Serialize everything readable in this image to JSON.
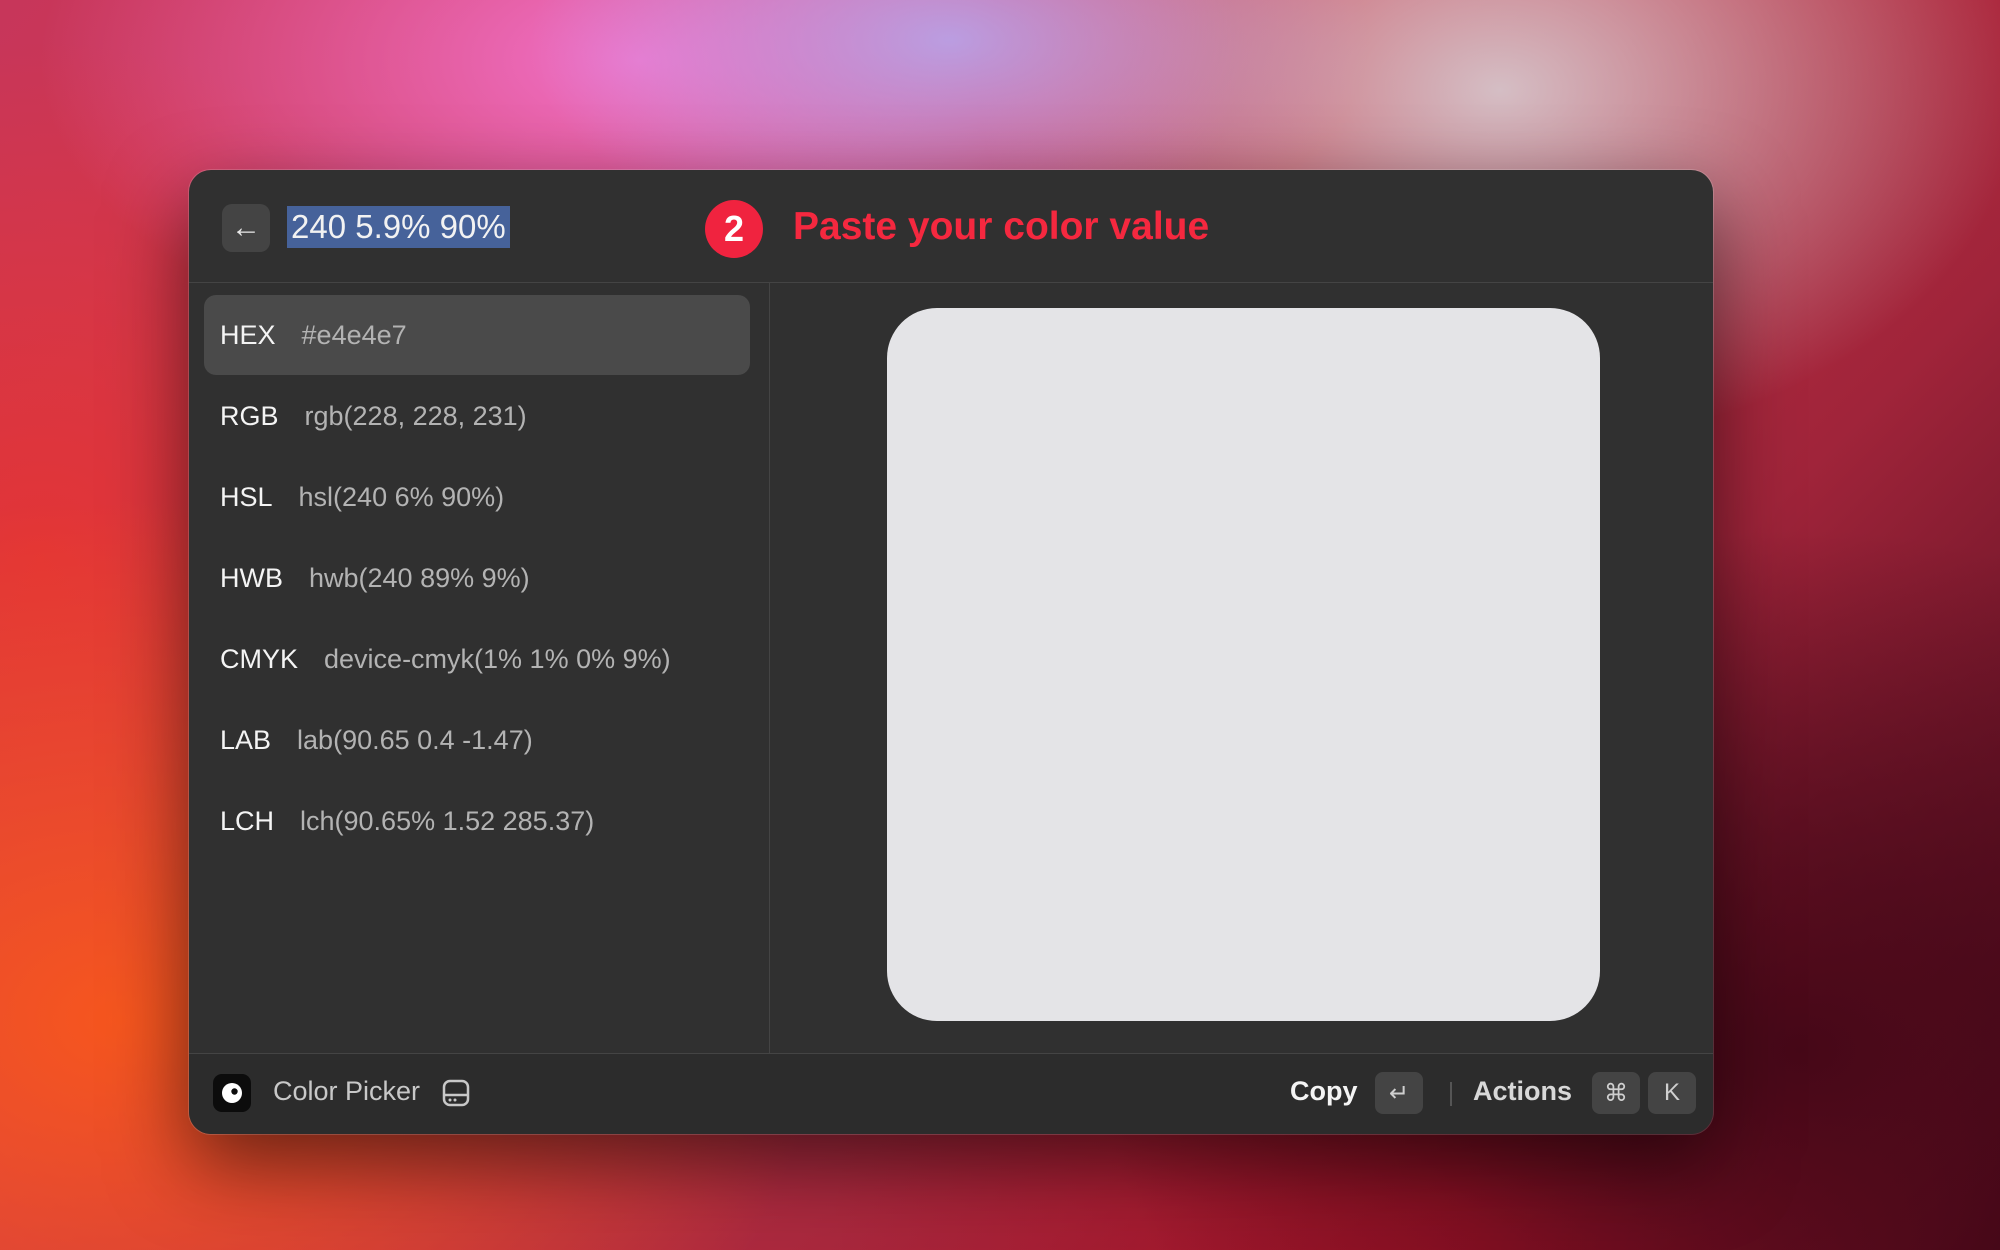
{
  "header": {
    "search_value": "240 5.9% 90%",
    "step_number": "2",
    "step_text": "Paste your color value"
  },
  "formats": [
    {
      "name": "HEX",
      "value": "#e4e4e7"
    },
    {
      "name": "RGB",
      "value": "rgb(228, 228, 231)"
    },
    {
      "name": "HSL",
      "value": "hsl(240 6% 90%)"
    },
    {
      "name": "HWB",
      "value": "hwb(240 89% 9%)"
    },
    {
      "name": "CMYK",
      "value": "device-cmyk(1% 1% 0% 9%)"
    },
    {
      "name": "LAB",
      "value": "lab(90.65 0.4 -1.47)"
    },
    {
      "name": "LCH",
      "value": "lch(90.65% 1.52 285.37)"
    }
  ],
  "preview": {
    "color": "#e4e4e7"
  },
  "footer": {
    "app_name": "Color Picker",
    "copy_label": "Copy",
    "enter_key": "↵",
    "actions_label": "Actions",
    "cmd_key": "⌘",
    "k_key": "K"
  },
  "colors": {
    "accent": "#f0233f",
    "selection": "#46629a"
  }
}
